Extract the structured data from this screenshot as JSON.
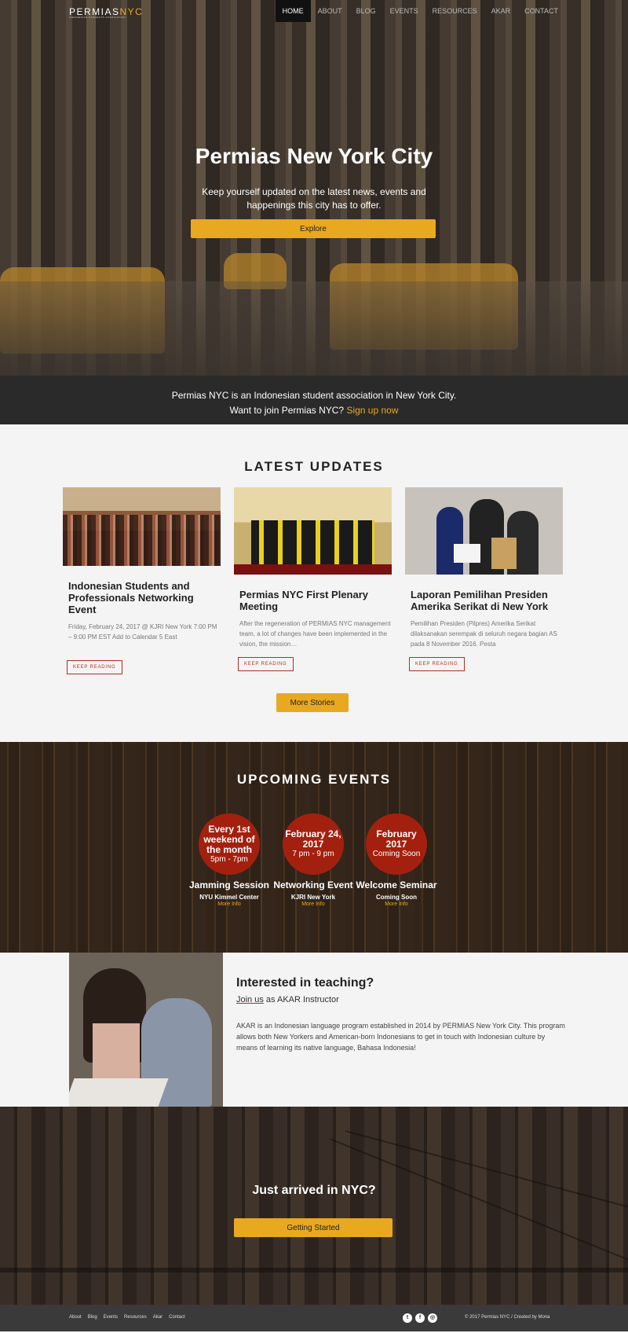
{
  "nav": {
    "logo_primary": "PERMIAS",
    "logo_accent": "NYC",
    "logo_sub": "INDONESIAN STUDENTS ASSOCIATION",
    "items": [
      {
        "label": "HOME",
        "active": true
      },
      {
        "label": "ABOUT"
      },
      {
        "label": "BLOG"
      },
      {
        "label": "EVENTS"
      },
      {
        "label": "RESOURCES"
      },
      {
        "label": "AKAR"
      },
      {
        "label": "CONTACT"
      }
    ]
  },
  "hero": {
    "title": "Permias New York City",
    "subtitle": "Keep yourself updated on the latest news, events and happenings this city has to offer.",
    "button": "Explore"
  },
  "infobar": {
    "line1": "Permias NYC is an Indonesian student association in New York City.",
    "line2": "Want to join Permias NYC?",
    "link": "Sign up now"
  },
  "updates": {
    "title": "LATEST UPDATES",
    "cards": [
      {
        "title": "Indonesian Students and Professionals Networking Event",
        "excerpt": "Friday, February 24, 2017 @ KJRI New York 7:00 PM – 9:00 PM EST Add to Calendar 5 East",
        "button": "KEEP READING"
      },
      {
        "title": "Permias NYC First Plenary Meeting",
        "excerpt": "After the regeneration of PERMIAS NYC management team, a lot of changes have been implemented in the vision, the mission…",
        "button": "KEEP READING"
      },
      {
        "title": "Laporan Pemilihan Presiden Amerika Serikat di New York",
        "excerpt": "Pemilihan Presiden (Pilpres) Amerika Serikat dilaksanakan serempak di seluruh negara bagian AS pada 8 November 2016. Pesta",
        "button": "KEEP READING"
      }
    ],
    "more_button": "More Stories"
  },
  "events": {
    "title": "UPCOMING EVENTS",
    "items": [
      {
        "date": "Every 1st weekend of the month",
        "time": "5pm - 7pm",
        "name": "Jamming Session",
        "location": "NYU Kimmel Center",
        "more": "More Info"
      },
      {
        "date": "February 24, 2017",
        "time": "7 pm - 9 pm",
        "name": "Networking Event",
        "location": "KJRI New York",
        "more": "More Info"
      },
      {
        "date": "February 2017",
        "time": "Coming Soon",
        "name": "Welcome Seminar",
        "location": "Coming Soon",
        "more": "More Info"
      }
    ]
  },
  "teaching": {
    "title": "Interested in teaching?",
    "join_link": "Join us",
    "join_rest": " as AKAR Instructor",
    "body": "AKAR is an Indonesian language program established in 2014 by PERMIAS New York City. This program allows both New Yorkers and American-born Indonesians to get in touch with Indonesian culture by means of learning its native language, Bahasa Indonesia!"
  },
  "arrived": {
    "title": "Just arrived in NYC?",
    "button": "Getting Started"
  },
  "footer": {
    "links": [
      "About",
      "Blog",
      "Events",
      "Resources",
      "Akar",
      "Contact"
    ],
    "social": [
      {
        "icon": "twitter-icon",
        "glyph": "t"
      },
      {
        "icon": "facebook-icon",
        "glyph": "f"
      },
      {
        "icon": "instagram-icon",
        "glyph": "◎"
      }
    ],
    "copyright": "© 2017 Permias NYC / Created by Mona"
  },
  "colors": {
    "accent_yellow": "#e8a921",
    "event_red": "#a3200f",
    "button_outline_red": "#b03020",
    "dark_bar": "#2a2a2a",
    "footer": "#3a3a3a"
  }
}
